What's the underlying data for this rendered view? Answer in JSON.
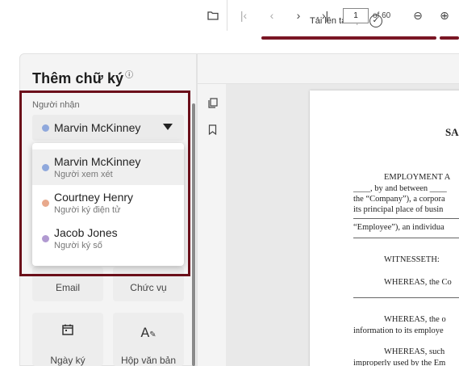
{
  "progress": {
    "step_label": "Tải lên tài liệu",
    "step_icon": "check-circle-icon",
    "accent": "#7a1624"
  },
  "panel": {
    "title": "Thêm chữ ký",
    "title_icon": "info-icon",
    "recipient_label": "Người nhận",
    "selected": {
      "name": "Marvin McKinney",
      "color": "#8fa8dc"
    },
    "options": [
      {
        "name": "Marvin McKinney",
        "role": "Người xem xét",
        "color": "#8fa8dc",
        "selected": true
      },
      {
        "name": "Courtney Henry",
        "role": "Người ký điện tử",
        "color": "#e8a98c",
        "selected": false
      },
      {
        "name": "Jacob Jones",
        "role": "Người ký số",
        "color": "#b19ad1",
        "selected": false
      }
    ],
    "fields": [
      {
        "label": "Email",
        "icon": ""
      },
      {
        "label": "Chức vụ",
        "icon": ""
      },
      {
        "label": "Ngày ký",
        "icon": "calendar-icon"
      },
      {
        "label": "Hộp văn bản",
        "icon": "text-box-icon"
      }
    ],
    "highlight_color": "#6b0f1a"
  },
  "toolbar": {
    "page_current": "1",
    "page_total": "of 60"
  },
  "document": {
    "heading": "SA",
    "lines": [
      "EMPLOYMENT  A",
      "____, by and between ____",
      "the “Company”), a corpora",
      "its principal place of busin",
      "“Employee”), an individua",
      "WITNESSETH:",
      "WHEREAS, the Co",
      "WHEREAS,  the  o",
      "information to its employe",
      "WHEREAS,  such",
      "improperly used by the Em"
    ]
  }
}
